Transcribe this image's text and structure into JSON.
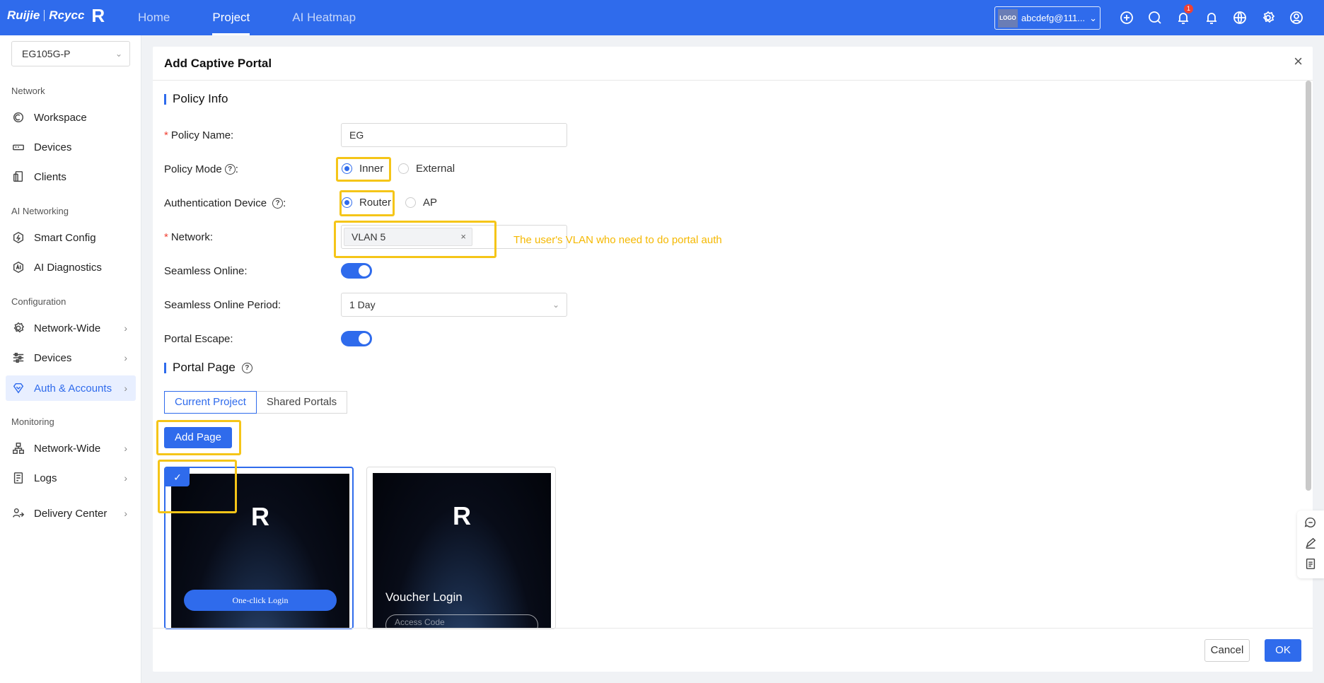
{
  "topbar": {
    "brand": "Ruijie",
    "brand2": "Rcycc",
    "nav": [
      "Home",
      "Project",
      "AI Heatmap"
    ],
    "account_logo": "LOGO",
    "account": "abcdefg@111....",
    "notification_count": "1"
  },
  "sidebar": {
    "device": "EG105G-P",
    "sections": {
      "network": "Network",
      "ai": "AI Networking",
      "config": "Configuration",
      "monitoring": "Monitoring"
    },
    "items": {
      "workspace": "Workspace",
      "devices": "Devices",
      "clients": "Clients",
      "smart_config": "Smart Config",
      "ai_diagnostics": "AI Diagnostics",
      "network_wide": "Network-Wide",
      "config_devices": "Devices",
      "auth_accounts": "Auth & Accounts",
      "mon_network_wide": "Network-Wide",
      "logs": "Logs",
      "delivery_center": "Delivery Center"
    }
  },
  "modal": {
    "title": "Add Captive Portal",
    "policy_info": "Policy Info",
    "labels": {
      "policy_name": "Policy Name:",
      "policy_mode": "Policy Mode",
      "auth_device": "Authentication Device",
      "network": "Network:",
      "seamless_online": "Seamless Online:",
      "seamless_period": "Seamless Online Period:",
      "portal_escape": "Portal Escape:"
    },
    "values": {
      "policy_name": "EG",
      "mode_inner": "Inner",
      "mode_external": "External",
      "dev_router": "Router",
      "dev_ap": "AP",
      "network_tag": "VLAN 5",
      "seamless_period": "1 Day"
    },
    "annotation": "The user's VLAN who need to do portal auth",
    "portal_page": "Portal Page",
    "tabs": [
      "Current Project",
      "Shared Portals"
    ],
    "add_page": "Add Page",
    "card1_button": "One-click Login",
    "card2_title": "Voucher Login",
    "card2_placeholder": "Access Code",
    "cancel": "Cancel",
    "ok": "OK"
  },
  "colors": {
    "primary": "#2f6bec",
    "highlight": "#f5c518",
    "annotation": "#f5b800"
  }
}
